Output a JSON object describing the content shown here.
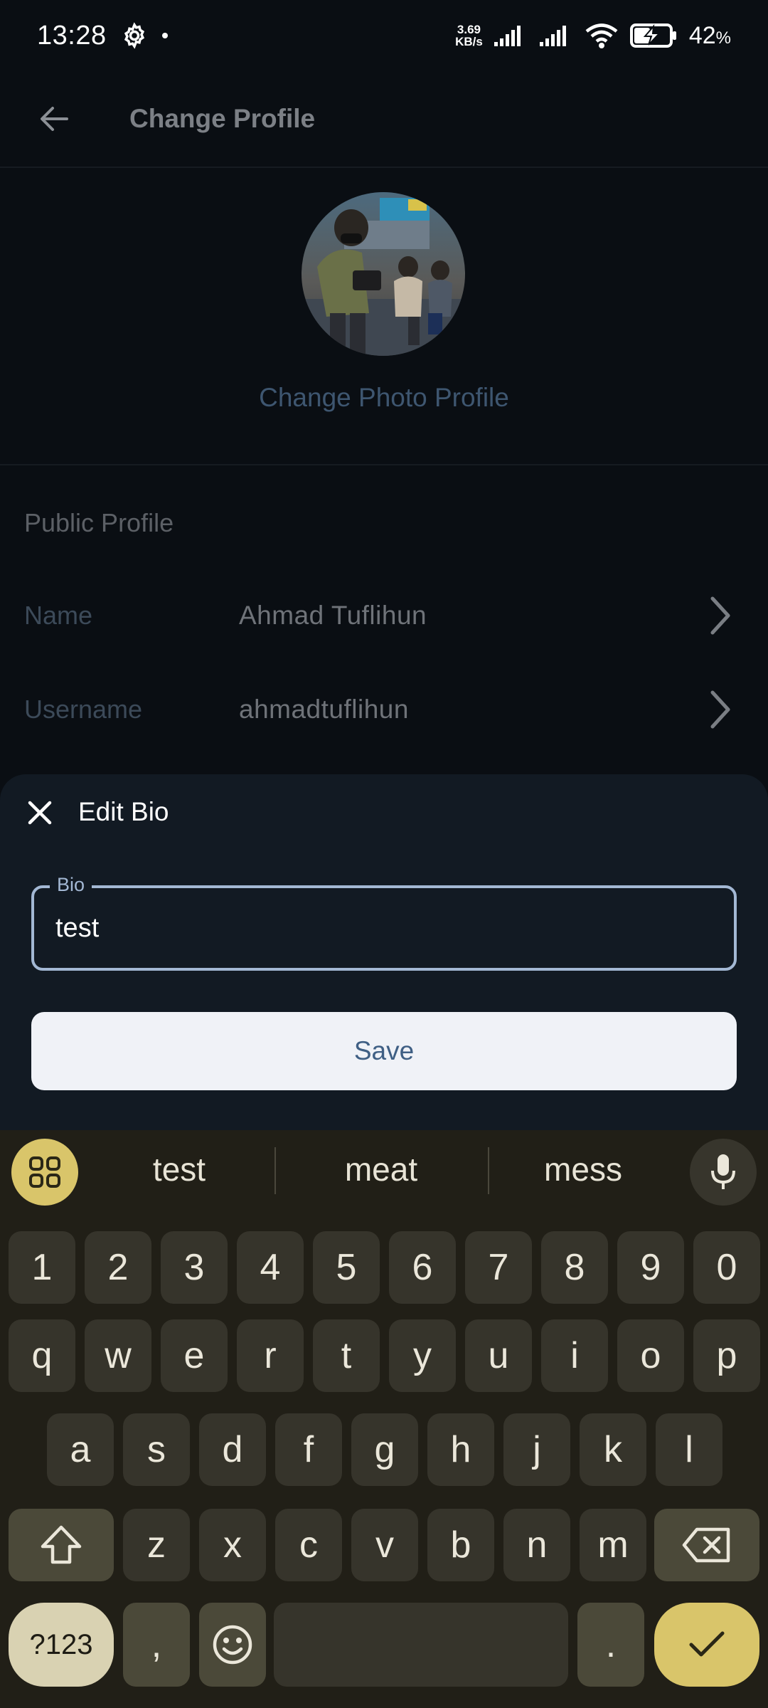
{
  "status_bar": {
    "time": "13:28",
    "net_speed_value": "3.69",
    "net_speed_unit": "KB/s",
    "battery_percent": "42",
    "battery_unit": "%"
  },
  "app_bar": {
    "title": "Change Profile"
  },
  "photo": {
    "change_label": "Change Photo Profile"
  },
  "public_profile": {
    "section_title": "Public Profile",
    "rows": [
      {
        "label": "Name",
        "value": "Ahmad Tuflihun"
      },
      {
        "label": "Username",
        "value": "ahmadtuflihun"
      }
    ]
  },
  "edit_bio_sheet": {
    "title": "Edit Bio",
    "field_label": "Bio",
    "field_value": "test",
    "save_label": "Save"
  },
  "keyboard": {
    "suggestions": [
      "test",
      "meat",
      "mess"
    ],
    "row_numbers": [
      "1",
      "2",
      "3",
      "4",
      "5",
      "6",
      "7",
      "8",
      "9",
      "0"
    ],
    "row_top": [
      "q",
      "w",
      "e",
      "r",
      "t",
      "y",
      "u",
      "i",
      "o",
      "p"
    ],
    "row_middle": [
      "a",
      "s",
      "d",
      "f",
      "g",
      "h",
      "j",
      "k",
      "l"
    ],
    "row_bottom": [
      "z",
      "x",
      "c",
      "v",
      "b",
      "n",
      "m"
    ],
    "symbols_label": "?123",
    "comma": ",",
    "period": "."
  },
  "colors": {
    "background": "#0a0e13",
    "sheet": "#121a23",
    "accent_blue": "#a3b8d4",
    "keyboard_bg": "#211f17",
    "keyboard_accent": "#d9c56a"
  }
}
